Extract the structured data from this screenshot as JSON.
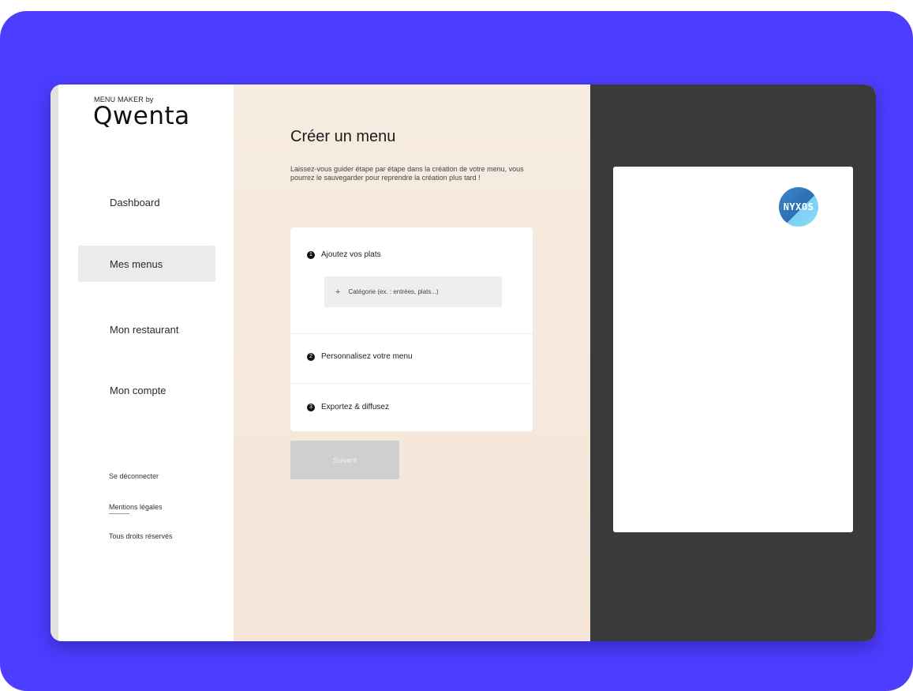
{
  "brand": {
    "small": "MENU MAKER by",
    "name": "Qwenta"
  },
  "sidebar": {
    "items": [
      {
        "label": "Dashboard",
        "active": false
      },
      {
        "label": "Mes menus",
        "active": true
      },
      {
        "label": "Mon restaurant",
        "active": false
      },
      {
        "label": "Mon compte",
        "active": false
      }
    ],
    "footer_links": [
      "Se déconnecter",
      "Mentions légales",
      "Tous droits réservés"
    ]
  },
  "main": {
    "title": "Créer un menu",
    "description": "Laissez-vous guider étape par étape dans la création de votre menu, vous pourrez le sauvegarder pour reprendre la création plus tard !",
    "steps": [
      {
        "number": "1",
        "label": "Ajoutez vos plats"
      },
      {
        "number": "2",
        "label": "Personnalisez votre menu"
      },
      {
        "number": "3",
        "label": "Exportez & diffusez"
      }
    ],
    "category_button": {
      "icon": "plus-icon",
      "label": "Catégorie (ex. : entrées, plats...)"
    },
    "next_button": "Suivant"
  },
  "preview": {
    "badge_text": "NYXOS"
  },
  "colors": {
    "background_frame": "#4c3dff",
    "center_panel": "#f6eadf",
    "preview_panel": "#3a3a3a",
    "next_button_disabled": "#cfcfcf"
  }
}
